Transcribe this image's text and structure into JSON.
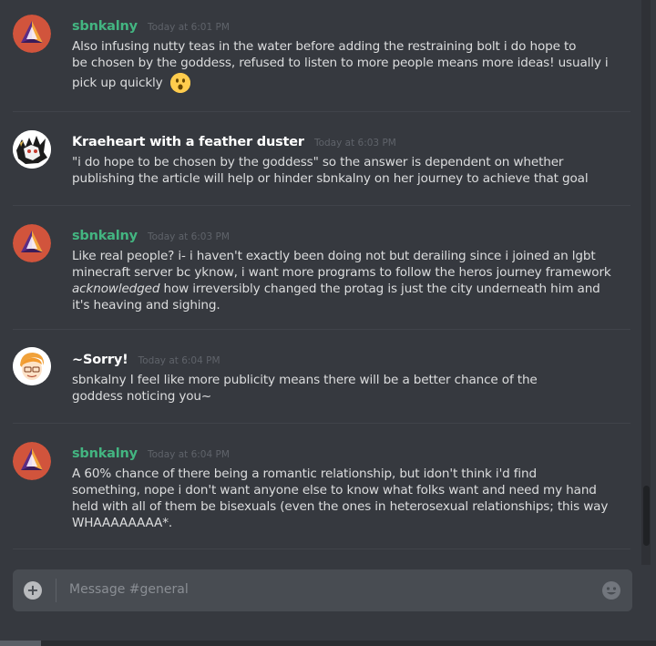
{
  "messages": [
    {
      "author": "sbnkalny",
      "timestamp": "Today at 6:01 PM",
      "avatar": "triangle-logo-avatar",
      "lines": [
        "Also infusing nutty teas in the water before adding the restraining bolt i do hope to",
        "be chosen by the goddess, refused to listen to more people means more ideas! usually i",
        "pick up quickly"
      ],
      "emoji": "hushed-face-emoji"
    },
    {
      "author": "Kraeheart with a feather duster",
      "timestamp": "Today at 6:03 PM",
      "avatar": "sketch-avatar",
      "lines": [
        "\"i do hope to be chosen by the goddess\" so the answer is dependent on whether",
        "publishing the article will help or hinder sbnkalny on her journey to achieve that goal"
      ]
    },
    {
      "author": "sbnkalny",
      "timestamp": "Today at 6:03 PM",
      "avatar": "triangle-logo-avatar",
      "lines": [
        "Like real people? i- i haven't exactly been doing not but derailing since i joined an lgbt",
        "minecraft server bc yknow, i want more programs to follow the heros journey framework",
        "how irreversibly changed the protag is just the city underneath him and",
        "it's heaving and sighing."
      ],
      "italic_word": "acknowledged"
    },
    {
      "author": "~Sorry!",
      "timestamp": "Today at 6:04 PM",
      "avatar": "cartoon-face-avatar",
      "lines": [
        "sbnkalny I feel like more publicity means there will be a better chance of the",
        "goddess noticing you~"
      ]
    },
    {
      "author": "sbnkalny",
      "timestamp": "Today at 6:04 PM",
      "avatar": "triangle-logo-avatar",
      "lines": [
        "A 60% chance of there being a romantic relationship, but idon't think i'd find",
        "something, nope i don't want anyone else to know what folks want and need my hand",
        "held with all of them be bisexuals (even the ones in heterosexual relationships; this way",
        "WHAAAAAAAA*."
      ]
    }
  ],
  "composer": {
    "placeholder": "Message #general",
    "plus_icon": "plus-circle-icon",
    "emoji_icon": "emoji-picker-icon"
  },
  "colors": {
    "background": "#36393f",
    "composer": "#484c52",
    "author_green": "#43b581",
    "author_white": "#ffffff",
    "timestamp": "#5f636a",
    "text": "#dcddde"
  }
}
